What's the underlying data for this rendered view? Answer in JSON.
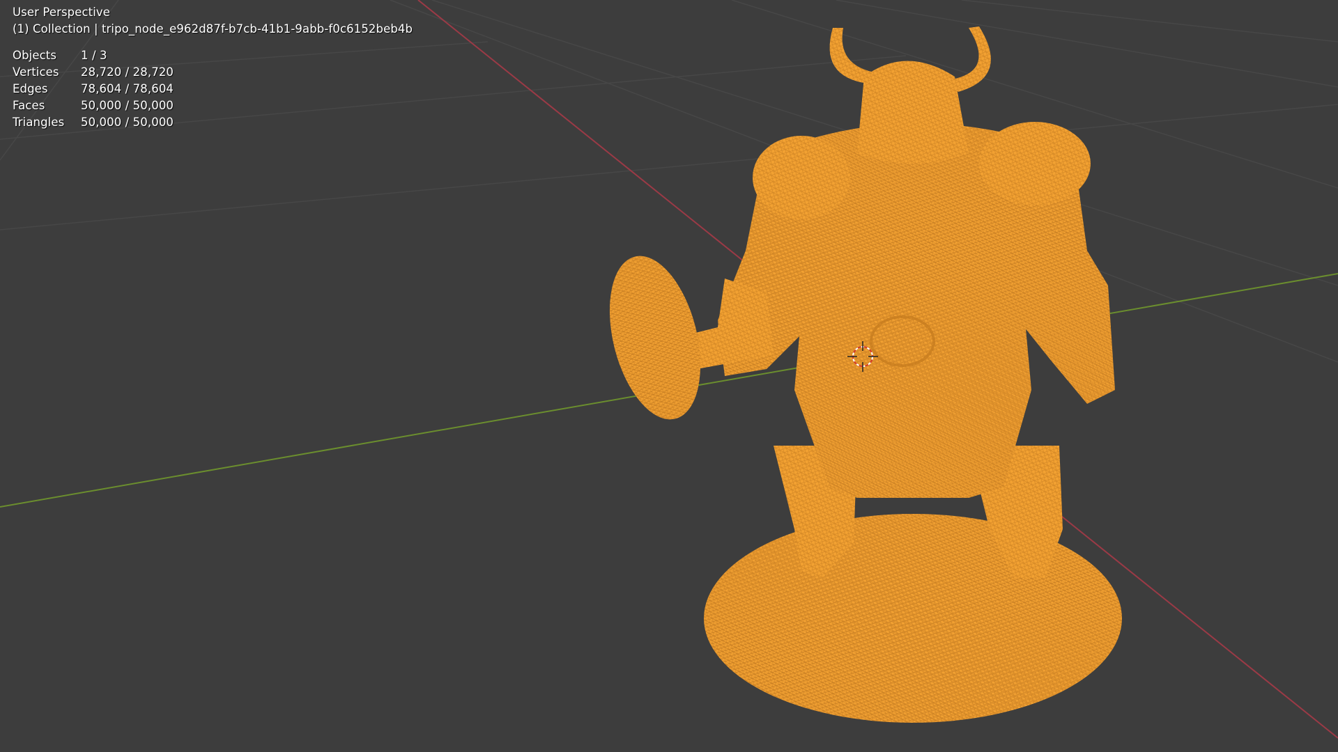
{
  "viewport": {
    "view_name": "User Perspective",
    "collection_label": "(1) Collection | tripo_node_e962d87f-b7cb-41b1-9abb-f0c6152beb4b",
    "background_color": "#3d3d3d",
    "grid_color": "#484848",
    "x_axis_color": "#9b3a46",
    "y_axis_color": "#6b8e2e",
    "mesh_color": "#f0a030",
    "mesh_wire_color": "#b8701a",
    "cursor_icon": "3d-cursor-icon"
  },
  "stats": [
    {
      "label": "Objects",
      "value": "1 / 3"
    },
    {
      "label": "Vertices",
      "value": "28,720 / 28,720"
    },
    {
      "label": "Edges",
      "value": "78,604 / 78,604"
    },
    {
      "label": "Faces",
      "value": "50,000 / 50,000"
    },
    {
      "label": "Triangles",
      "value": "50,000 / 50,000"
    }
  ]
}
